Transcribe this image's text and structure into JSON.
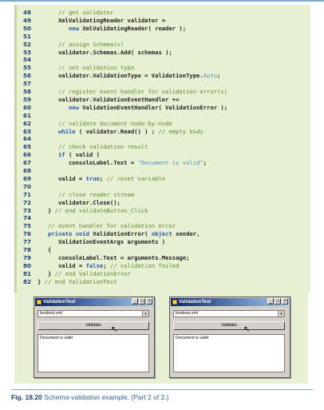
{
  "code_lines": [
    {
      "num": "48",
      "html": "      <span class=\"cm\">// get validator</span>"
    },
    {
      "num": "49",
      "html": "      XmlValidatingReader validator ="
    },
    {
      "num": "50",
      "html": "         <span class=\"kw\">new</span> XmlValidatingReader( reader );"
    },
    {
      "num": "51",
      "html": ""
    },
    {
      "num": "52",
      "html": "      <span class=\"cm\">// assign Schema(s)</span>"
    },
    {
      "num": "53",
      "html": "      validator.Schemas.Add( schemas );"
    },
    {
      "num": "54",
      "html": ""
    },
    {
      "num": "55",
      "html": "      <span class=\"cm\">// set validation type</span>"
    },
    {
      "num": "56",
      "html": "      validator.ValidationType = ValidationType.<span class=\"st\">Auto</span>;"
    },
    {
      "num": "57",
      "html": ""
    },
    {
      "num": "58",
      "html": "      <span class=\"cm\">// register event handler for validation error(s)</span>"
    },
    {
      "num": "59",
      "html": "      validator.ValidationEventHandler +="
    },
    {
      "num": "60",
      "html": "         <span class=\"kw\">new</span> ValidationEventHandler( ValidationError );"
    },
    {
      "num": "61",
      "html": ""
    },
    {
      "num": "62",
      "html": "      <span class=\"cm\">// validate document node-by-node</span>"
    },
    {
      "num": "63",
      "html": "      <span class=\"kw\">while</span> ( validator.Read() ) ; <span class=\"cm\">// empty body</span>"
    },
    {
      "num": "64",
      "html": ""
    },
    {
      "num": "65",
      "html": "      <span class=\"cm\">// check validation result</span>"
    },
    {
      "num": "66",
      "html": "      <span class=\"kw\">if</span> ( valid )"
    },
    {
      "num": "67",
      "html": "         consoleLabel.Text = <span class=\"st\">\"Document is valid\"</span>;"
    },
    {
      "num": "68",
      "html": ""
    },
    {
      "num": "69",
      "html": "      valid = <span class=\"kw\">true</span>; <span class=\"cm\">// reset variable</span>"
    },
    {
      "num": "70",
      "html": ""
    },
    {
      "num": "71",
      "html": "      <span class=\"cm\">// close reader stream</span>"
    },
    {
      "num": "72",
      "html": "      validator.Close();"
    },
    {
      "num": "73",
      "html": "   } <span class=\"cm\">// end validateButton_Click</span>"
    },
    {
      "num": "74",
      "html": ""
    },
    {
      "num": "75",
      "html": "   <span class=\"cm\">// event handler for validation error</span>"
    },
    {
      "num": "76",
      "html": "   <span class=\"kw\">private void</span> ValidationError( <span class=\"kw\">object</span> sender,"
    },
    {
      "num": "77",
      "html": "      ValidationEventArgs arguments )"
    },
    {
      "num": "78",
      "html": "   {"
    },
    {
      "num": "79",
      "html": "      consoleLabel.Text = arguments.Message;"
    },
    {
      "num": "80",
      "html": "      valid = <span class=\"kw\">false</span>; <span class=\"cm\">// validation failed</span>"
    },
    {
      "num": "81",
      "html": "   } <span class=\"cm\">// end ValidationError</span>"
    },
    {
      "num": "82",
      "html": "} <span class=\"cm\">// end ValidationTest</span>"
    }
  ],
  "windows": [
    {
      "title": "ValidationTest",
      "file": "bookout.xml",
      "button": "Validate",
      "status": "Document is valid"
    },
    {
      "title": "ValidationTest",
      "file": "bookout.xml",
      "button": "Validate",
      "status": "Document is valid"
    }
  ],
  "caption": {
    "label": "Fig. 18.20",
    "text": "Schema-validation example. (Part 2 of 2.)"
  },
  "colors": {
    "code_bg": "#e7f0d2",
    "keyword": "#2b55b8",
    "comment": "#5b8a2c",
    "caption": "#2c5f99"
  }
}
